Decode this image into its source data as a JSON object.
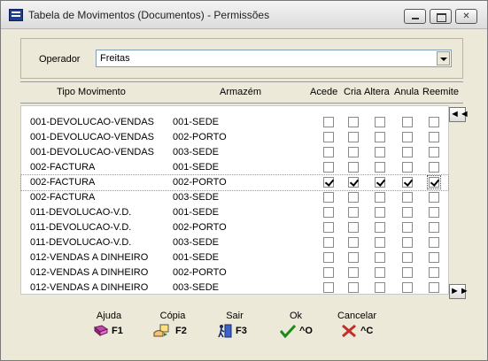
{
  "window": {
    "title": "Tabela de Movimentos (Documentos) - Permissões"
  },
  "operator": {
    "label": "Operador",
    "value": "Freitas"
  },
  "headers": {
    "tipo": "Tipo Movimento",
    "armazem": "Armazém",
    "acede": "Acede",
    "cria": "Cria",
    "altera": "Altera",
    "anula": "Anula",
    "reemite": "Reemite"
  },
  "rows": [
    {
      "tipo": "001-DEVOLUCAO-VENDAS",
      "armazem": "001-SEDE",
      "acede": false,
      "cria": false,
      "altera": false,
      "anula": false,
      "reemite": false
    },
    {
      "tipo": "001-DEVOLUCAO-VENDAS",
      "armazem": "002-PORTO",
      "acede": false,
      "cria": false,
      "altera": false,
      "anula": false,
      "reemite": false
    },
    {
      "tipo": "001-DEVOLUCAO-VENDAS",
      "armazem": "003-SEDE",
      "acede": false,
      "cria": false,
      "altera": false,
      "anula": false,
      "reemite": false
    },
    {
      "tipo": "002-FACTURA",
      "armazem": "001-SEDE",
      "acede": false,
      "cria": false,
      "altera": false,
      "anula": false,
      "reemite": false
    },
    {
      "tipo": "002-FACTURA",
      "armazem": "002-PORTO",
      "acede": true,
      "cria": true,
      "altera": true,
      "anula": true,
      "reemite": true
    },
    {
      "tipo": "002-FACTURA",
      "armazem": "003-SEDE",
      "acede": false,
      "cria": false,
      "altera": false,
      "anula": false,
      "reemite": false
    },
    {
      "tipo": "011-DEVOLUCAO-V.D.",
      "armazem": "001-SEDE",
      "acede": false,
      "cria": false,
      "altera": false,
      "anula": false,
      "reemite": false
    },
    {
      "tipo": "011-DEVOLUCAO-V.D.",
      "armazem": "002-PORTO",
      "acede": false,
      "cria": false,
      "altera": false,
      "anula": false,
      "reemite": false
    },
    {
      "tipo": "011-DEVOLUCAO-V.D.",
      "armazem": "003-SEDE",
      "acede": false,
      "cria": false,
      "altera": false,
      "anula": false,
      "reemite": false
    },
    {
      "tipo": "012-VENDAS A DINHEIRO",
      "armazem": "001-SEDE",
      "acede": false,
      "cria": false,
      "altera": false,
      "anula": false,
      "reemite": false
    },
    {
      "tipo": "012-VENDAS A DINHEIRO",
      "armazem": "002-PORTO",
      "acede": false,
      "cria": false,
      "altera": false,
      "anula": false,
      "reemite": false
    },
    {
      "tipo": "012-VENDAS A DINHEIRO",
      "armazem": "003-SEDE",
      "acede": false,
      "cria": false,
      "altera": false,
      "anula": false,
      "reemite": false
    }
  ],
  "nav": {
    "prev": "◄◄",
    "next": "►►"
  },
  "buttons": {
    "ajuda": {
      "label": "Ajuda",
      "key": "F1",
      "icon": "book-icon"
    },
    "copia": {
      "label": "Cópia",
      "key": "F2",
      "icon": "copy-hand-icon"
    },
    "sair": {
      "label": "Sair",
      "key": "F3",
      "icon": "exit-door-icon"
    },
    "ok": {
      "label": "Ok",
      "key": "^O",
      "icon": "checkmark-icon"
    },
    "cancelar": {
      "label": "Cancelar",
      "key": "^C",
      "icon": "x-cross-icon"
    }
  },
  "colors": {
    "check_green": "#1a8a1a",
    "cancel_red": "#c0302a",
    "book_purple": "#a03090"
  }
}
